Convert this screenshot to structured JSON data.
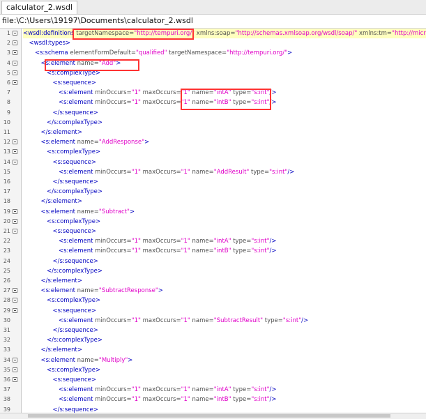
{
  "tab": {
    "label": "calculator_2.wsdl"
  },
  "path": {
    "text": "file:\\C:\\Users\\19197\\Documents\\calculator_2.wsdl"
  },
  "lines": [
    {
      "n": "1",
      "fold": true,
      "indent": 0,
      "hl": true,
      "parts": [
        [
          "tag",
          "<wsdl:definitions"
        ],
        [
          "attr",
          " targetNamespace="
        ],
        [
          "val",
          "\"http://tempuri.org/\""
        ],
        [
          "attr",
          " xmlns:soap="
        ],
        [
          "val",
          "\"http://schemas.xmlsoap.org/wsdl/soap/\""
        ],
        [
          "attr",
          " xmlns:tm="
        ],
        [
          "val",
          "\"http://microso"
        ]
      ]
    },
    {
      "n": "2",
      "fold": true,
      "indent": 1,
      "parts": [
        [
          "tag",
          "<wsdl:types>"
        ]
      ]
    },
    {
      "n": "3",
      "fold": true,
      "indent": 2,
      "parts": [
        [
          "tag",
          "<s:schema"
        ],
        [
          "attr",
          " elementFormDefault="
        ],
        [
          "val",
          "\"qualified\""
        ],
        [
          "attr",
          " targetNamespace="
        ],
        [
          "val",
          "\"http://tempuri.org/\""
        ],
        [
          "tag",
          ">"
        ]
      ]
    },
    {
      "n": "4",
      "fold": true,
      "indent": 3,
      "parts": [
        [
          "tag",
          "<s:element"
        ],
        [
          "attr",
          " name="
        ],
        [
          "val",
          "\"Add\""
        ],
        [
          "tag",
          ">"
        ]
      ]
    },
    {
      "n": "5",
      "fold": true,
      "indent": 4,
      "parts": [
        [
          "tag",
          "<s:complexType>"
        ]
      ]
    },
    {
      "n": "6",
      "fold": true,
      "indent": 5,
      "parts": [
        [
          "tag",
          "<s:sequence>"
        ]
      ]
    },
    {
      "n": "7",
      "fold": false,
      "indent": 6,
      "parts": [
        [
          "tag",
          "<s:element"
        ],
        [
          "attr",
          " minOccurs="
        ],
        [
          "val",
          "\"1\""
        ],
        [
          "attr",
          " maxOccurs="
        ],
        [
          "val",
          "\"1\""
        ],
        [
          "attr",
          " name="
        ],
        [
          "val",
          "\"intA\""
        ],
        [
          "attr",
          " type="
        ],
        [
          "val",
          "\"s:int\""
        ],
        [
          "tag",
          "/>"
        ]
      ]
    },
    {
      "n": "8",
      "fold": false,
      "indent": 6,
      "parts": [
        [
          "tag",
          "<s:element"
        ],
        [
          "attr",
          " minOccurs="
        ],
        [
          "val",
          "\"1\""
        ],
        [
          "attr",
          " maxOccurs="
        ],
        [
          "val",
          "\"1\""
        ],
        [
          "attr",
          " name="
        ],
        [
          "val",
          "\"intB\""
        ],
        [
          "attr",
          " type="
        ],
        [
          "val",
          "\"s:int\""
        ],
        [
          "tag",
          "/>"
        ]
      ]
    },
    {
      "n": "9",
      "fold": false,
      "indent": 5,
      "parts": [
        [
          "tag",
          "</s:sequence>"
        ]
      ]
    },
    {
      "n": "10",
      "fold": false,
      "indent": 4,
      "parts": [
        [
          "tag",
          "</s:complexType>"
        ]
      ]
    },
    {
      "n": "11",
      "fold": false,
      "indent": 3,
      "parts": [
        [
          "tag",
          "</s:element>"
        ]
      ]
    },
    {
      "n": "12",
      "fold": true,
      "indent": 3,
      "parts": [
        [
          "tag",
          "<s:element"
        ],
        [
          "attr",
          " name="
        ],
        [
          "val",
          "\"AddResponse\""
        ],
        [
          "tag",
          ">"
        ]
      ]
    },
    {
      "n": "13",
      "fold": true,
      "indent": 4,
      "parts": [
        [
          "tag",
          "<s:complexType>"
        ]
      ]
    },
    {
      "n": "14",
      "fold": true,
      "indent": 5,
      "parts": [
        [
          "tag",
          "<s:sequence>"
        ]
      ]
    },
    {
      "n": "15",
      "fold": false,
      "indent": 6,
      "parts": [
        [
          "tag",
          "<s:element"
        ],
        [
          "attr",
          " minOccurs="
        ],
        [
          "val",
          "\"1\""
        ],
        [
          "attr",
          " maxOccurs="
        ],
        [
          "val",
          "\"1\""
        ],
        [
          "attr",
          " name="
        ],
        [
          "val",
          "\"AddResult\""
        ],
        [
          "attr",
          " type="
        ],
        [
          "val",
          "\"s:int\""
        ],
        [
          "tag",
          "/>"
        ]
      ]
    },
    {
      "n": "16",
      "fold": false,
      "indent": 5,
      "parts": [
        [
          "tag",
          "</s:sequence>"
        ]
      ]
    },
    {
      "n": "17",
      "fold": false,
      "indent": 4,
      "parts": [
        [
          "tag",
          "</s:complexType>"
        ]
      ]
    },
    {
      "n": "18",
      "fold": false,
      "indent": 3,
      "parts": [
        [
          "tag",
          "</s:element>"
        ]
      ]
    },
    {
      "n": "19",
      "fold": true,
      "indent": 3,
      "parts": [
        [
          "tag",
          "<s:element"
        ],
        [
          "attr",
          " name="
        ],
        [
          "val",
          "\"Subtract\""
        ],
        [
          "tag",
          ">"
        ]
      ]
    },
    {
      "n": "20",
      "fold": true,
      "indent": 4,
      "parts": [
        [
          "tag",
          "<s:complexType>"
        ]
      ]
    },
    {
      "n": "21",
      "fold": true,
      "indent": 5,
      "parts": [
        [
          "tag",
          "<s:sequence>"
        ]
      ]
    },
    {
      "n": "22",
      "fold": false,
      "indent": 6,
      "parts": [
        [
          "tag",
          "<s:element"
        ],
        [
          "attr",
          " minOccurs="
        ],
        [
          "val",
          "\"1\""
        ],
        [
          "attr",
          " maxOccurs="
        ],
        [
          "val",
          "\"1\""
        ],
        [
          "attr",
          " name="
        ],
        [
          "val",
          "\"intA\""
        ],
        [
          "attr",
          " type="
        ],
        [
          "val",
          "\"s:int\""
        ],
        [
          "tag",
          "/>"
        ]
      ]
    },
    {
      "n": "23",
      "fold": false,
      "indent": 6,
      "parts": [
        [
          "tag",
          "<s:element"
        ],
        [
          "attr",
          " minOccurs="
        ],
        [
          "val",
          "\"1\""
        ],
        [
          "attr",
          " maxOccurs="
        ],
        [
          "val",
          "\"1\""
        ],
        [
          "attr",
          " name="
        ],
        [
          "val",
          "\"intB\""
        ],
        [
          "attr",
          " type="
        ],
        [
          "val",
          "\"s:int\""
        ],
        [
          "tag",
          "/>"
        ]
      ]
    },
    {
      "n": "24",
      "fold": false,
      "indent": 5,
      "parts": [
        [
          "tag",
          "</s:sequence>"
        ]
      ]
    },
    {
      "n": "25",
      "fold": false,
      "indent": 4,
      "parts": [
        [
          "tag",
          "</s:complexType>"
        ]
      ]
    },
    {
      "n": "26",
      "fold": false,
      "indent": 3,
      "parts": [
        [
          "tag",
          "</s:element>"
        ]
      ]
    },
    {
      "n": "27",
      "fold": true,
      "indent": 3,
      "parts": [
        [
          "tag",
          "<s:element"
        ],
        [
          "attr",
          " name="
        ],
        [
          "val",
          "\"SubtractResponse\""
        ],
        [
          "tag",
          ">"
        ]
      ]
    },
    {
      "n": "28",
      "fold": true,
      "indent": 4,
      "parts": [
        [
          "tag",
          "<s:complexType>"
        ]
      ]
    },
    {
      "n": "29",
      "fold": true,
      "indent": 5,
      "parts": [
        [
          "tag",
          "<s:sequence>"
        ]
      ]
    },
    {
      "n": "30",
      "fold": false,
      "indent": 6,
      "parts": [
        [
          "tag",
          "<s:element"
        ],
        [
          "attr",
          " minOccurs="
        ],
        [
          "val",
          "\"1\""
        ],
        [
          "attr",
          " maxOccurs="
        ],
        [
          "val",
          "\"1\""
        ],
        [
          "attr",
          " name="
        ],
        [
          "val",
          "\"SubtractResult\""
        ],
        [
          "attr",
          " type="
        ],
        [
          "val",
          "\"s:int\""
        ],
        [
          "tag",
          "/>"
        ]
      ]
    },
    {
      "n": "31",
      "fold": false,
      "indent": 5,
      "parts": [
        [
          "tag",
          "</s:sequence>"
        ]
      ]
    },
    {
      "n": "32",
      "fold": false,
      "indent": 4,
      "parts": [
        [
          "tag",
          "</s:complexType>"
        ]
      ]
    },
    {
      "n": "33",
      "fold": false,
      "indent": 3,
      "parts": [
        [
          "tag",
          "</s:element>"
        ]
      ]
    },
    {
      "n": "34",
      "fold": true,
      "indent": 3,
      "parts": [
        [
          "tag",
          "<s:element"
        ],
        [
          "attr",
          " name="
        ],
        [
          "val",
          "\"Multiply\""
        ],
        [
          "tag",
          ">"
        ]
      ]
    },
    {
      "n": "35",
      "fold": true,
      "indent": 4,
      "parts": [
        [
          "tag",
          "<s:complexType>"
        ]
      ]
    },
    {
      "n": "36",
      "fold": true,
      "indent": 5,
      "parts": [
        [
          "tag",
          "<s:sequence>"
        ]
      ]
    },
    {
      "n": "37",
      "fold": false,
      "indent": 6,
      "parts": [
        [
          "tag",
          "<s:element"
        ],
        [
          "attr",
          " minOccurs="
        ],
        [
          "val",
          "\"1\""
        ],
        [
          "attr",
          " maxOccurs="
        ],
        [
          "val",
          "\"1\""
        ],
        [
          "attr",
          " name="
        ],
        [
          "val",
          "\"intA\""
        ],
        [
          "attr",
          " type="
        ],
        [
          "val",
          "\"s:int\""
        ],
        [
          "tag",
          "/>"
        ]
      ]
    },
    {
      "n": "38",
      "fold": false,
      "indent": 6,
      "parts": [
        [
          "tag",
          "<s:element"
        ],
        [
          "attr",
          " minOccurs="
        ],
        [
          "val",
          "\"1\""
        ],
        [
          "attr",
          " maxOccurs="
        ],
        [
          "val",
          "\"1\""
        ],
        [
          "attr",
          " name="
        ],
        [
          "val",
          "\"intB\""
        ],
        [
          "attr",
          " type="
        ],
        [
          "val",
          "\"s:int\""
        ],
        [
          "tag",
          "/>"
        ]
      ]
    },
    {
      "n": "39",
      "fold": false,
      "indent": 5,
      "parts": [
        [
          "tag",
          "</s:sequence>"
        ]
      ]
    }
  ]
}
